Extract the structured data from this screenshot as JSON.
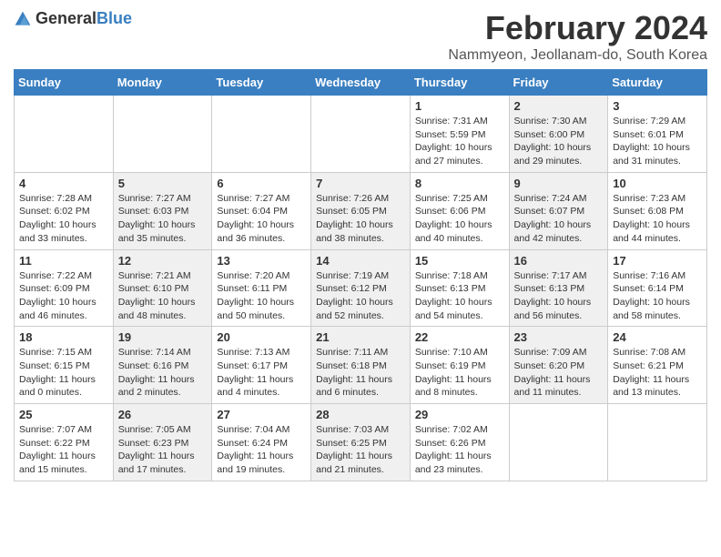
{
  "header": {
    "logo_general": "General",
    "logo_blue": "Blue",
    "title": "February 2024",
    "subtitle": "Nammyeon, Jeollanam-do, South Korea"
  },
  "days_of_week": [
    "Sunday",
    "Monday",
    "Tuesday",
    "Wednesday",
    "Thursday",
    "Friday",
    "Saturday"
  ],
  "weeks": [
    [
      {
        "day": "",
        "info": "",
        "shaded": false
      },
      {
        "day": "",
        "info": "",
        "shaded": false
      },
      {
        "day": "",
        "info": "",
        "shaded": false
      },
      {
        "day": "",
        "info": "",
        "shaded": false
      },
      {
        "day": "1",
        "info": "Sunrise: 7:31 AM\nSunset: 5:59 PM\nDaylight: 10 hours\nand 27 minutes.",
        "shaded": false
      },
      {
        "day": "2",
        "info": "Sunrise: 7:30 AM\nSunset: 6:00 PM\nDaylight: 10 hours\nand 29 minutes.",
        "shaded": true
      },
      {
        "day": "3",
        "info": "Sunrise: 7:29 AM\nSunset: 6:01 PM\nDaylight: 10 hours\nand 31 minutes.",
        "shaded": false
      }
    ],
    [
      {
        "day": "4",
        "info": "Sunrise: 7:28 AM\nSunset: 6:02 PM\nDaylight: 10 hours\nand 33 minutes.",
        "shaded": false
      },
      {
        "day": "5",
        "info": "Sunrise: 7:27 AM\nSunset: 6:03 PM\nDaylight: 10 hours\nand 35 minutes.",
        "shaded": true
      },
      {
        "day": "6",
        "info": "Sunrise: 7:27 AM\nSunset: 6:04 PM\nDaylight: 10 hours\nand 36 minutes.",
        "shaded": false
      },
      {
        "day": "7",
        "info": "Sunrise: 7:26 AM\nSunset: 6:05 PM\nDaylight: 10 hours\nand 38 minutes.",
        "shaded": true
      },
      {
        "day": "8",
        "info": "Sunrise: 7:25 AM\nSunset: 6:06 PM\nDaylight: 10 hours\nand 40 minutes.",
        "shaded": false
      },
      {
        "day": "9",
        "info": "Sunrise: 7:24 AM\nSunset: 6:07 PM\nDaylight: 10 hours\nand 42 minutes.",
        "shaded": true
      },
      {
        "day": "10",
        "info": "Sunrise: 7:23 AM\nSunset: 6:08 PM\nDaylight: 10 hours\nand 44 minutes.",
        "shaded": false
      }
    ],
    [
      {
        "day": "11",
        "info": "Sunrise: 7:22 AM\nSunset: 6:09 PM\nDaylight: 10 hours\nand 46 minutes.",
        "shaded": false
      },
      {
        "day": "12",
        "info": "Sunrise: 7:21 AM\nSunset: 6:10 PM\nDaylight: 10 hours\nand 48 minutes.",
        "shaded": true
      },
      {
        "day": "13",
        "info": "Sunrise: 7:20 AM\nSunset: 6:11 PM\nDaylight: 10 hours\nand 50 minutes.",
        "shaded": false
      },
      {
        "day": "14",
        "info": "Sunrise: 7:19 AM\nSunset: 6:12 PM\nDaylight: 10 hours\nand 52 minutes.",
        "shaded": true
      },
      {
        "day": "15",
        "info": "Sunrise: 7:18 AM\nSunset: 6:13 PM\nDaylight: 10 hours\nand 54 minutes.",
        "shaded": false
      },
      {
        "day": "16",
        "info": "Sunrise: 7:17 AM\nSunset: 6:13 PM\nDaylight: 10 hours\nand 56 minutes.",
        "shaded": true
      },
      {
        "day": "17",
        "info": "Sunrise: 7:16 AM\nSunset: 6:14 PM\nDaylight: 10 hours\nand 58 minutes.",
        "shaded": false
      }
    ],
    [
      {
        "day": "18",
        "info": "Sunrise: 7:15 AM\nSunset: 6:15 PM\nDaylight: 11 hours\nand 0 minutes.",
        "shaded": false
      },
      {
        "day": "19",
        "info": "Sunrise: 7:14 AM\nSunset: 6:16 PM\nDaylight: 11 hours\nand 2 minutes.",
        "shaded": true
      },
      {
        "day": "20",
        "info": "Sunrise: 7:13 AM\nSunset: 6:17 PM\nDaylight: 11 hours\nand 4 minutes.",
        "shaded": false
      },
      {
        "day": "21",
        "info": "Sunrise: 7:11 AM\nSunset: 6:18 PM\nDaylight: 11 hours\nand 6 minutes.",
        "shaded": true
      },
      {
        "day": "22",
        "info": "Sunrise: 7:10 AM\nSunset: 6:19 PM\nDaylight: 11 hours\nand 8 minutes.",
        "shaded": false
      },
      {
        "day": "23",
        "info": "Sunrise: 7:09 AM\nSunset: 6:20 PM\nDaylight: 11 hours\nand 11 minutes.",
        "shaded": true
      },
      {
        "day": "24",
        "info": "Sunrise: 7:08 AM\nSunset: 6:21 PM\nDaylight: 11 hours\nand 13 minutes.",
        "shaded": false
      }
    ],
    [
      {
        "day": "25",
        "info": "Sunrise: 7:07 AM\nSunset: 6:22 PM\nDaylight: 11 hours\nand 15 minutes.",
        "shaded": false
      },
      {
        "day": "26",
        "info": "Sunrise: 7:05 AM\nSunset: 6:23 PM\nDaylight: 11 hours\nand 17 minutes.",
        "shaded": true
      },
      {
        "day": "27",
        "info": "Sunrise: 7:04 AM\nSunset: 6:24 PM\nDaylight: 11 hours\nand 19 minutes.",
        "shaded": false
      },
      {
        "day": "28",
        "info": "Sunrise: 7:03 AM\nSunset: 6:25 PM\nDaylight: 11 hours\nand 21 minutes.",
        "shaded": true
      },
      {
        "day": "29",
        "info": "Sunrise: 7:02 AM\nSunset: 6:26 PM\nDaylight: 11 hours\nand 23 minutes.",
        "shaded": false
      },
      {
        "day": "",
        "info": "",
        "shaded": false
      },
      {
        "day": "",
        "info": "",
        "shaded": false
      }
    ]
  ]
}
